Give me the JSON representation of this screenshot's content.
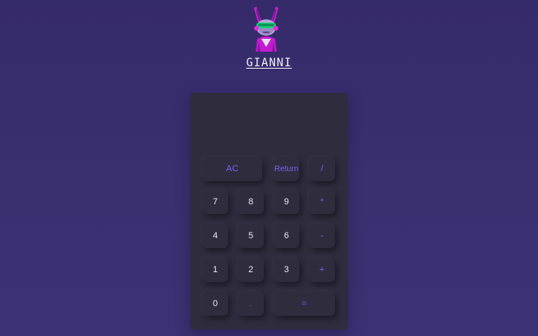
{
  "header": {
    "avatar_icon": "bunny-vr-avatar-icon",
    "name": "GIANNI"
  },
  "calculator": {
    "display_value": "",
    "keys": {
      "ac": "AC",
      "return": "Return",
      "divide": "/",
      "seven": "7",
      "eight": "8",
      "nine": "9",
      "multiply": "*",
      "four": "4",
      "five": "5",
      "six": "6",
      "minus": "-",
      "one": "1",
      "two": "2",
      "three": "3",
      "plus": "+",
      "zero": "0",
      "dot": ".",
      "equals": "="
    }
  },
  "colors": {
    "background": "#382d6e",
    "panel": "#2f2c3e",
    "operator": "#7b62f2",
    "digit": "#e9e7f3"
  }
}
